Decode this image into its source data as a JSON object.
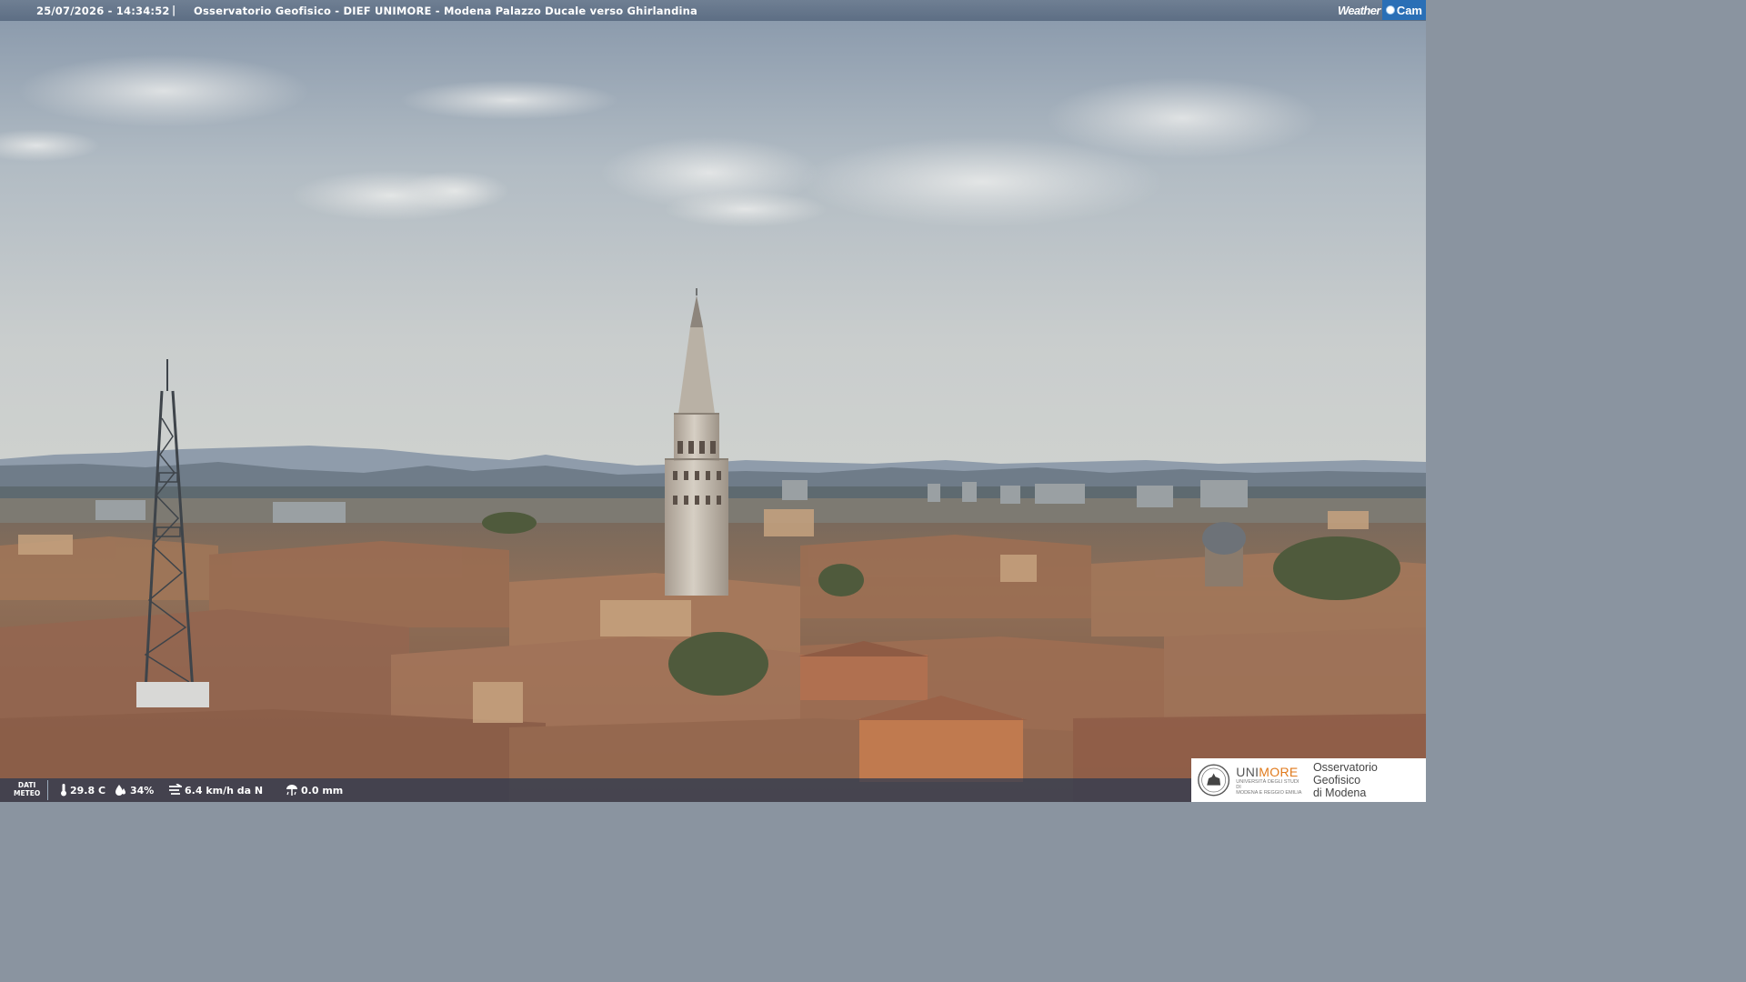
{
  "header": {
    "timestamp": "25/07/2026 - 14:34:52",
    "separator": "|",
    "title": "Osservatorio Geofisico - DIEF UNIMORE - Modena Palazzo Ducale verso Ghirlandina",
    "brand_weather": "Weather",
    "brand_cam": "Cam"
  },
  "weather": {
    "label_line1": "DATI",
    "label_line2": "METEO",
    "temperature": "29.8 C",
    "humidity": "34%",
    "wind": "6.4 km/h da N",
    "rain": "0.0 mm"
  },
  "logo": {
    "uni_prefix": "UNI",
    "uni_suffix": "MORE",
    "uni_sub1": "UNIVERSITÀ DEGLI STUDI DI",
    "uni_sub2": "MODENA E REGGIO EMILIA",
    "observatory_line1": "Osservatorio Geofisico",
    "observatory_line2": "di Modena"
  },
  "colors": {
    "sky_top": "#8c9cae",
    "sky_mid": "#c3c9cc",
    "roof": "#9a6a4e",
    "tower": "#c9c1b5",
    "accent_orange": "#e07a1c",
    "cam_blue": "#2a6fb6"
  },
  "icons": [
    "thermometer-icon",
    "humidity-icon",
    "wind-icon",
    "rain-gauge-icon",
    "camera-icon"
  ]
}
